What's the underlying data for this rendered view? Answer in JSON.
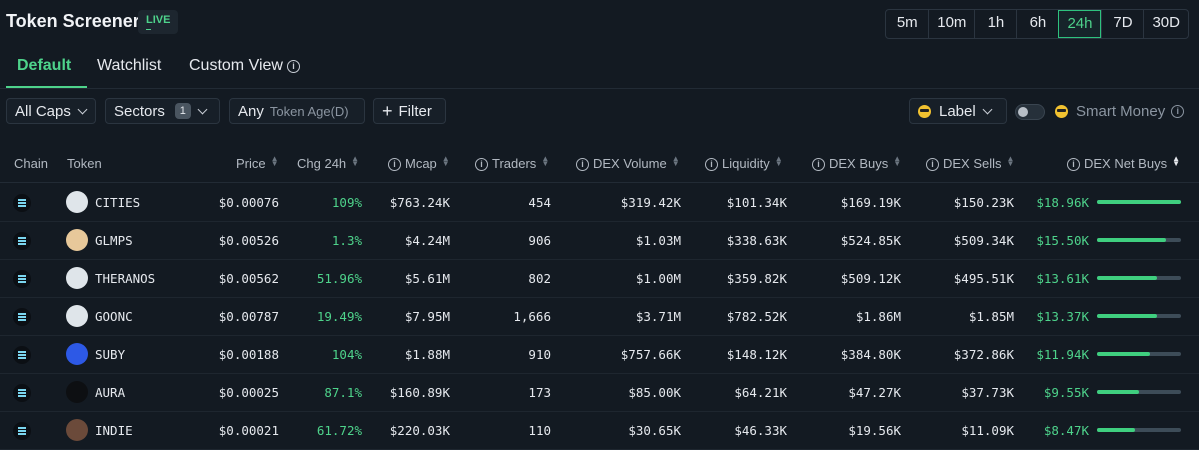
{
  "header": {
    "title": "Token Screener",
    "live_badge": "LIVE",
    "timeframes": [
      "5m",
      "10m",
      "1h",
      "6h",
      "24h",
      "7D",
      "30D"
    ],
    "active_timeframe": "24h"
  },
  "tabs": [
    {
      "label": "Default",
      "active": true
    },
    {
      "label": "Watchlist",
      "active": false
    },
    {
      "label": "Custom View",
      "active": false
    }
  ],
  "filters": {
    "caps": "All Caps",
    "sectors": "Sectors",
    "sectors_count": "1",
    "age_any": "Any",
    "age_label": "Token Age(D)",
    "filter": "Filter",
    "label": "Label",
    "smart_money": "Smart Money",
    "smart_money_enabled": false
  },
  "table": {
    "columns": [
      "Chain",
      "Token",
      "Price",
      "Chg 24h",
      "Mcap",
      "Traders",
      "DEX Volume",
      "Liquidity",
      "DEX Buys",
      "DEX Sells",
      "DEX Net Buys"
    ],
    "rows": [
      {
        "token": "CITIES",
        "price": "$0.00076",
        "chg": "109%",
        "mcap": "$763.24K",
        "traders": "454",
        "volume": "$319.42K",
        "liquidity": "$101.34K",
        "buys": "$169.19K",
        "sells": "$150.23K",
        "net": "$18.96K",
        "net_ratio": 1.0,
        "icon": "cities-icon",
        "icon_color": "#dfe5ea"
      },
      {
        "token": "GLMPS",
        "price": "$0.00526",
        "chg": "1.3%",
        "mcap": "$4.24M",
        "traders": "906",
        "volume": "$1.03M",
        "liquidity": "$338.63K",
        "buys": "$524.85K",
        "sells": "$509.34K",
        "net": "$15.50K",
        "net_ratio": 0.82,
        "icon": "glmps-icon",
        "icon_color": "#e7c89a"
      },
      {
        "token": "THERANOS",
        "price": "$0.00562",
        "chg": "51.96%",
        "mcap": "$5.61M",
        "traders": "802",
        "volume": "$1.00M",
        "liquidity": "$359.82K",
        "buys": "$509.12K",
        "sells": "$495.51K",
        "net": "$13.61K",
        "net_ratio": 0.72,
        "icon": "theranos-icon",
        "icon_color": "#dfe5ea"
      },
      {
        "token": "GOONC",
        "price": "$0.00787",
        "chg": "19.49%",
        "mcap": "$7.95M",
        "traders": "1,666",
        "volume": "$3.71M",
        "liquidity": "$782.52K",
        "buys": "$1.86M",
        "sells": "$1.85M",
        "net": "$13.37K",
        "net_ratio": 0.71,
        "icon": "goonc-icon",
        "icon_color": "#dfe5ea"
      },
      {
        "token": "SUBY",
        "price": "$0.00188",
        "chg": "104%",
        "mcap": "$1.88M",
        "traders": "910",
        "volume": "$757.66K",
        "liquidity": "$148.12K",
        "buys": "$384.80K",
        "sells": "$372.86K",
        "net": "$11.94K",
        "net_ratio": 0.63,
        "icon": "suby-icon",
        "icon_color": "#2d59e6"
      },
      {
        "token": "AURA",
        "price": "$0.00025",
        "chg": "87.1%",
        "mcap": "$160.89K",
        "traders": "173",
        "volume": "$85.00K",
        "liquidity": "$64.21K",
        "buys": "$47.27K",
        "sells": "$37.73K",
        "net": "$9.55K",
        "net_ratio": 0.5,
        "icon": "aura-icon",
        "icon_color": "#0d0f12"
      },
      {
        "token": "INDIE",
        "price": "$0.00021",
        "chg": "61.72%",
        "mcap": "$220.03K",
        "traders": "110",
        "volume": "$30.65K",
        "liquidity": "$46.33K",
        "buys": "$19.56K",
        "sells": "$11.09K",
        "net": "$8.47K",
        "net_ratio": 0.45,
        "icon": "indie-icon",
        "icon_color": "#6b4a3a"
      }
    ]
  }
}
